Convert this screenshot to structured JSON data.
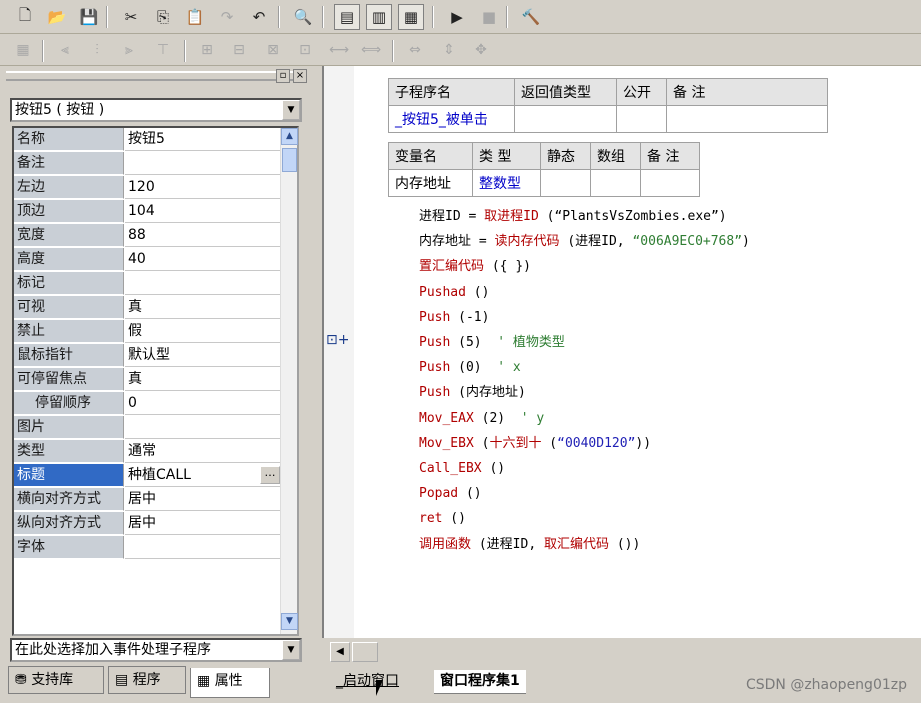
{
  "toolbar1": {
    "icons": [
      "new-file-icon",
      "open-folder-icon",
      "save-icon",
      "cut-icon",
      "copy-icon",
      "paste-icon",
      "redo-icon",
      "undo-icon",
      "find-icon",
      "layout1-icon",
      "layout2-icon",
      "layout3-icon",
      "run-icon",
      "stop-icon",
      "compile-icon"
    ],
    "glyphs": [
      "🗋",
      "📂",
      "💾",
      "✂",
      "⎘",
      "📋",
      "↷",
      "↶",
      "🔍",
      "▤",
      "▥",
      "▦",
      "▶",
      "■",
      "🔨"
    ]
  },
  "left_panel": {
    "object_combo": "按钮5 ( 按钮 )",
    "event_combo": "在此处选择加入事件处理子程序",
    "properties": [
      {
        "name": "名称",
        "value": "按钮5"
      },
      {
        "name": "备注",
        "value": ""
      },
      {
        "name": "左边",
        "value": "120"
      },
      {
        "name": "顶边",
        "value": "104"
      },
      {
        "name": "宽度",
        "value": "88"
      },
      {
        "name": "高度",
        "value": "40"
      },
      {
        "name": "标记",
        "value": ""
      },
      {
        "name": "可视",
        "value": "真"
      },
      {
        "name": "禁止",
        "value": "假"
      },
      {
        "name": "鼠标指针",
        "value": "默认型"
      },
      {
        "name": "可停留焦点",
        "value": "真"
      },
      {
        "name": "停留顺序",
        "value": "0"
      },
      {
        "name": "图片",
        "value": ""
      },
      {
        "name": "类型",
        "value": "通常"
      },
      {
        "name": "标题",
        "value": "种植CALL"
      },
      {
        "name": "横向对齐方式",
        "value": "居中"
      },
      {
        "name": "纵向对齐方式",
        "value": "居中"
      },
      {
        "name": "字体",
        "value": ""
      }
    ],
    "tabs": [
      {
        "label": "支持库"
      },
      {
        "label": "程序"
      },
      {
        "label": "属性"
      }
    ]
  },
  "editor": {
    "sub_header": [
      "子程序名",
      "返回值类型",
      "公开",
      "备 注"
    ],
    "sub_row": [
      "_按钮5_被单击",
      "",
      "",
      ""
    ],
    "var_header": [
      "变量名",
      "类 型",
      "静态",
      "数组",
      "备 注"
    ],
    "var_row": [
      "内存地址",
      "整数型",
      "",
      "",
      ""
    ],
    "gutter_marker": "⊡+",
    "code": [
      [
        {
          "t": "进程ID = ",
          "c": "blk"
        },
        {
          "t": "取进程ID",
          "c": "red"
        },
        {
          "t": " (“PlantsVsZombies.exe”)",
          "c": "blk"
        }
      ],
      [
        {
          "t": "内存地址 = ",
          "c": "blk"
        },
        {
          "t": "读内存代码",
          "c": "red"
        },
        {
          "t": " (进程ID, ",
          "c": "blk"
        },
        {
          "t": "“006A9EC0+768”",
          "c": "green"
        },
        {
          "t": ")",
          "c": "blk"
        }
      ],
      [
        {
          "t": "置汇编代码",
          "c": "red"
        },
        {
          "t": " ({ })",
          "c": "blk"
        }
      ],
      [
        {
          "t": "Pushad",
          "c": "red"
        },
        {
          "t": " ()",
          "c": "blk"
        }
      ],
      [
        {
          "t": "Push",
          "c": "red"
        },
        {
          "t": " (-1)",
          "c": "blk"
        }
      ],
      [
        {
          "t": "Push",
          "c": "red"
        },
        {
          "t": " (5)  ",
          "c": "blk"
        },
        {
          "t": "' 植物类型",
          "c": "green"
        }
      ],
      [
        {
          "t": "Push",
          "c": "red"
        },
        {
          "t": " (0)  ",
          "c": "blk"
        },
        {
          "t": "' x",
          "c": "green"
        }
      ],
      [
        {
          "t": "Push",
          "c": "red"
        },
        {
          "t": " (内存地址)",
          "c": "blk"
        }
      ],
      [
        {
          "t": "Mov_EAX",
          "c": "red"
        },
        {
          "t": " (2)  ",
          "c": "blk"
        },
        {
          "t": "' y",
          "c": "green"
        }
      ],
      [
        {
          "t": "Mov_EBX",
          "c": "red"
        },
        {
          "t": " (",
          "c": "blk"
        },
        {
          "t": "十六到十",
          "c": "red"
        },
        {
          "t": " (",
          "c": "blk"
        },
        {
          "t": "“0040D120”",
          "c": "blue"
        },
        {
          "t": "))",
          "c": "blk"
        }
      ],
      [
        {
          "t": "Call_EBX",
          "c": "red"
        },
        {
          "t": " ()",
          "c": "blk"
        }
      ],
      [
        {
          "t": "Popad",
          "c": "red"
        },
        {
          "t": " ()",
          "c": "blk"
        }
      ],
      [
        {
          "t": "ret",
          "c": "red"
        },
        {
          "t": " ()",
          "c": "blk"
        }
      ],
      [
        {
          "t": "调用函数",
          "c": "red"
        },
        {
          "t": " (进程ID, ",
          "c": "blk"
        },
        {
          "t": "取汇编代码",
          "c": "red"
        },
        {
          "t": " ())",
          "c": "blk"
        }
      ]
    ]
  },
  "bottom_tabs": {
    "tab1": "_启动窗口",
    "tab2": "窗口程序集1"
  },
  "watermark": "CSDN @zhaopeng01zp"
}
